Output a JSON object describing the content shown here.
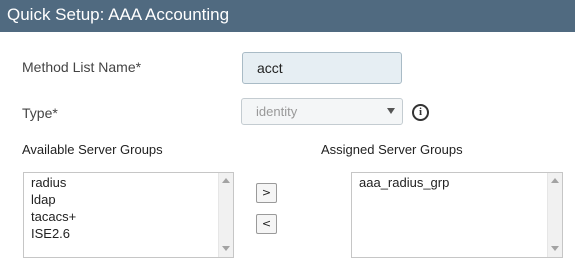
{
  "window": {
    "title": "Quick Setup: AAA Accounting"
  },
  "form": {
    "method_list_name": {
      "label": "Method List Name*",
      "value": "acct"
    },
    "type": {
      "label": "Type*",
      "selected": "identity",
      "info_glyph": "i",
      "icon": "info-icon"
    }
  },
  "available_groups": {
    "heading": "Available Server Groups",
    "items": [
      "radius",
      "ldap",
      "tacacs+",
      "ISE2.6"
    ]
  },
  "assigned_groups": {
    "heading": "Assigned Server Groups",
    "items": [
      "aaa_radius_grp"
    ]
  },
  "buttons": {
    "move_right": ">",
    "move_left": "<"
  },
  "colors": {
    "titlebar": "#506a80",
    "input_bg": "#e6eef3"
  }
}
